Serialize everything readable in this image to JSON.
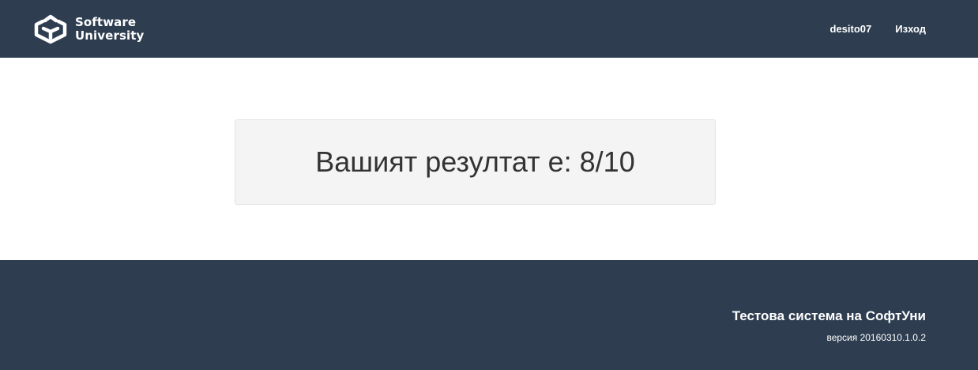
{
  "navbar": {
    "brand": {
      "line1": "Software",
      "line2": "University",
      "icon": "softuni-logo-icon"
    },
    "links": [
      {
        "label": "desito07"
      },
      {
        "label": "Изход"
      }
    ]
  },
  "result": {
    "text": "Вашият резултат е: 8/10"
  },
  "footer": {
    "title": "Тестова система на СофтУни",
    "version": "версия 20160310.1.0.2"
  },
  "colors": {
    "navbar_bg": "#2e3d50",
    "footer_bg": "#2e3d50",
    "result_box_bg": "#f4f4f4",
    "text": "#333333"
  }
}
